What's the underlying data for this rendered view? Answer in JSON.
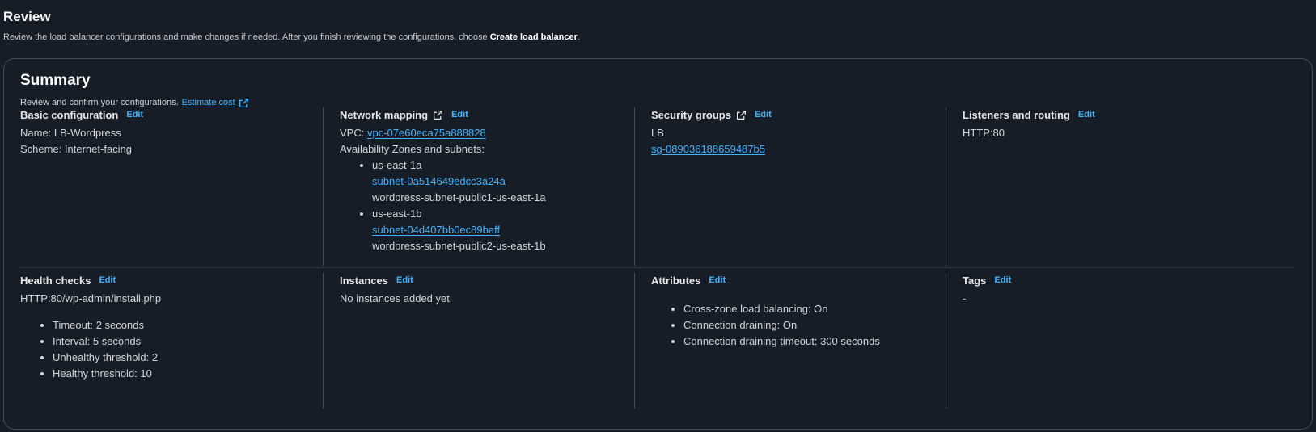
{
  "header": {
    "title": "Review",
    "desc_prefix": "Review the load balancer configurations and make changes if needed. After you finish reviewing the configurations, choose ",
    "desc_bold": "Create load balancer",
    "desc_suffix": "."
  },
  "summary": {
    "title": "Summary",
    "desc": "Review and confirm your configurations.",
    "estimate_link": "Estimate cost"
  },
  "edit_label": "Edit",
  "basic": {
    "title": "Basic configuration",
    "name": "Name: LB-Wordpress",
    "scheme": "Scheme: Internet-facing"
  },
  "network": {
    "title": "Network mapping",
    "vpc_label": "VPC: ",
    "vpc_link": "vpc-07e60eca75a888828",
    "az_label": "Availability Zones and subnets:",
    "zones": [
      {
        "zone": "us-east-1a",
        "subnet": "subnet-0a514649edcc3a24a",
        "name": "wordpress-subnet-public1-us-east-1a"
      },
      {
        "zone": "us-east-1b",
        "subnet": "subnet-04d407bb0ec89baff",
        "name": "wordpress-subnet-public2-us-east-1b"
      }
    ]
  },
  "security": {
    "title": "Security groups",
    "group_name": "LB",
    "group_link": "sg-089036188659487b5"
  },
  "listeners": {
    "title": "Listeners and routing",
    "value": "HTTP:80"
  },
  "health": {
    "title": "Health checks",
    "path": "HTTP:80/wp-admin/install.php",
    "items": [
      "Timeout: 2 seconds",
      "Interval: 5 seconds",
      "Unhealthy threshold: 2",
      "Healthy threshold: 10"
    ]
  },
  "instances": {
    "title": "Instances",
    "value": "No instances added yet"
  },
  "attributes": {
    "title": "Attributes",
    "items": [
      "Cross-zone load balancing: On",
      "Connection draining: On",
      "Connection draining timeout: 300 seconds"
    ]
  },
  "tags": {
    "title": "Tags",
    "value": "-"
  },
  "colors": {
    "background": "#161d26",
    "link": "#42b4ff",
    "border": "#414d5c"
  }
}
